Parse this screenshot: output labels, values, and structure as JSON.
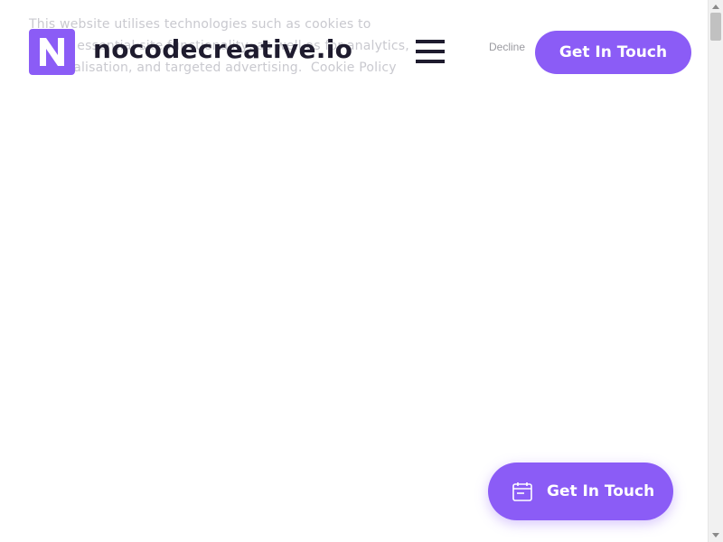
{
  "cookie_banner": {
    "text": "This website utilises technologies such as cookies to enable essential site functionality, as well as for analytics, personalisation, and targeted advertising.",
    "policy_link": "Cookie Policy",
    "decline_label": "Decline"
  },
  "header": {
    "logo_letter": "N",
    "brand_name": "nocodecreative.io",
    "menu_icon": "hamburger-icon",
    "cta_label": "Get In Touch"
  },
  "floating_cta": {
    "label": "Get In Touch",
    "icon": "calendar-icon"
  },
  "colors": {
    "accent": "#8b5cf6",
    "text_dark": "#1e1b2e"
  }
}
